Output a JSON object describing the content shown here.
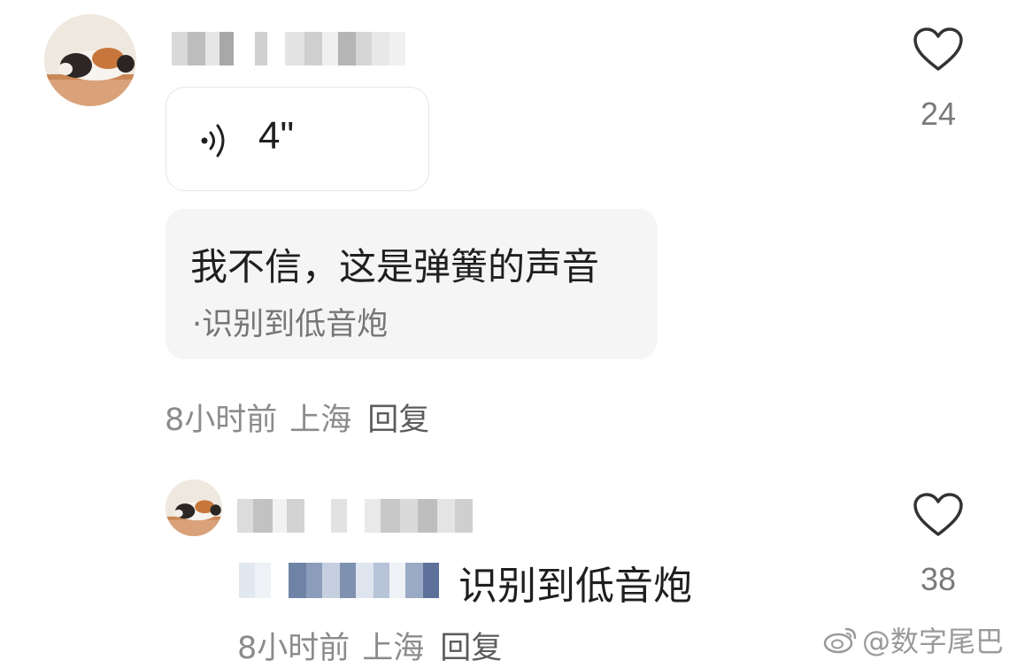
{
  "comment": {
    "voice_duration": "4\"",
    "text": "我不信，这是弹簧的声音",
    "recognized": "·识别到低音炮",
    "time": "8小时前",
    "location": "上海",
    "reply_label": "回复",
    "like_count": "24"
  },
  "reply": {
    "text": "识别到低音炮",
    "time": "8小时前",
    "location": "上海",
    "reply_label": "回复",
    "like_count": "38"
  },
  "watermark": "@数字尾巴",
  "icons": [
    "heart-outline-icon",
    "voice-wave-icon",
    "weibo-logo-icon"
  ],
  "colors": {
    "text": "#1f1f1f",
    "meta": "#8b8b8b",
    "bubble": "#f5f5f5"
  }
}
